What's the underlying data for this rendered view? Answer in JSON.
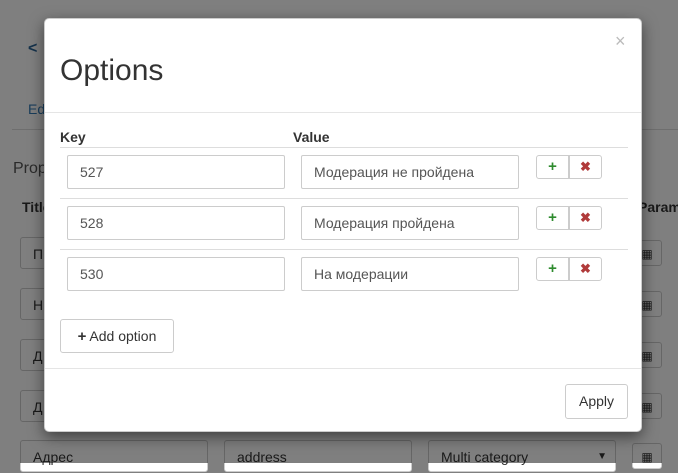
{
  "background": {
    "back_icon": "chevron-left-icon",
    "tab_label": "Ed",
    "section_heading": "Prop",
    "col_title": "Title",
    "col_params": "Param",
    "rows": [
      {
        "title": "П"
      },
      {
        "title": "Н"
      },
      {
        "title": "Д"
      },
      {
        "title": "Д"
      }
    ],
    "last_row": {
      "title": "Адрес",
      "key": "address",
      "type": "Multi category"
    }
  },
  "modal": {
    "title": "Options",
    "close_label": "×",
    "columns": {
      "key": "Key",
      "value": "Value"
    },
    "options": [
      {
        "key": "527",
        "value": "Модерация не пройдена"
      },
      {
        "key": "528",
        "value": "Модерация пройдена"
      },
      {
        "key": "530",
        "value": "На модерации"
      }
    ],
    "row_add_icon": "+",
    "row_remove_icon": "✖",
    "add_option_icon": "+",
    "add_option_label": "Add option",
    "apply_label": "Apply"
  },
  "colors": {
    "add_icon": "#2e8b2e",
    "remove_icon": "#b03a3a",
    "backdrop": "rgba(0,0,0,0.5)"
  }
}
